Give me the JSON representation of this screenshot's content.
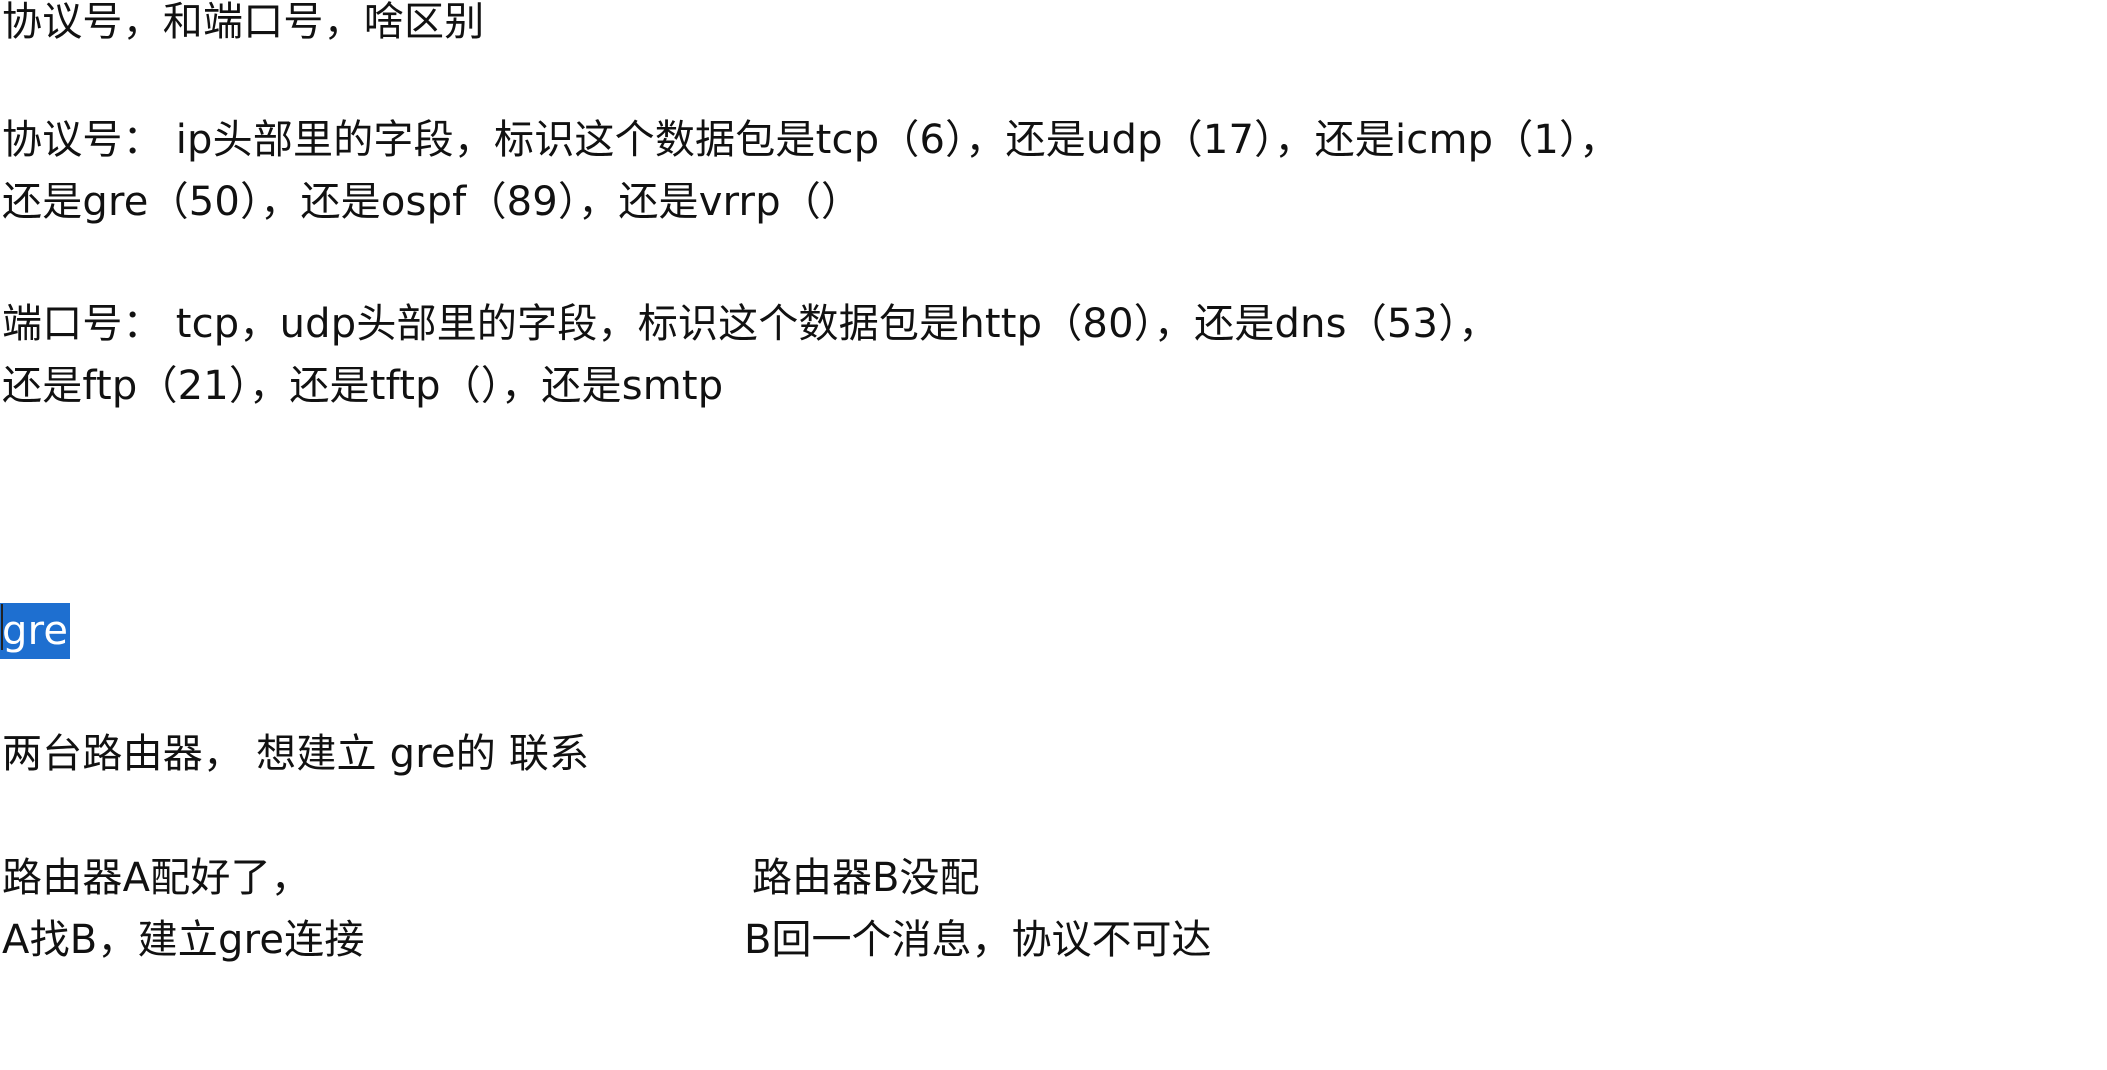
{
  "document": {
    "title_line": "协议号，和端口号，啥区别",
    "protocol_lines": [
      "协议号： ip头部里的字段，标识这个数据包是tcp（6），还是udp（17），还是icmp（1），",
      "还是gre（50），还是ospf（89），还是vrrp（）"
    ],
    "port_lines": [
      "端口号： tcp，udp头部里的字段，标识这个数据包是http（80），还是dns（53），",
      "还是ftp（21），还是tftp（），还是smtp"
    ],
    "selected_word": "gre",
    "gre_intro": "两台路由器， 想建立 gre的 联系",
    "router_a": {
      "line1": "路由器A配好了，",
      "line2": "A找B，建立gre连接"
    },
    "router_b": {
      "line1": "路由器B没配",
      "line2": "B回一个消息，协议不可达"
    }
  },
  "colors": {
    "text": "#111111",
    "selection": "#1e6fd0",
    "background": "#ffffff"
  }
}
